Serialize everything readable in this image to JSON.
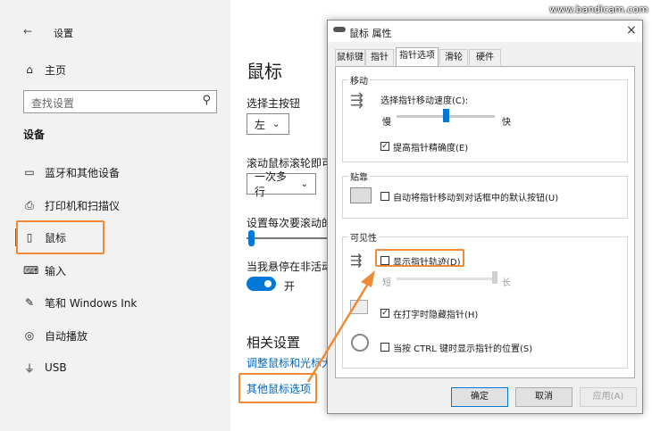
{
  "watermark": "www.bandicam.com",
  "settings": {
    "title": "设置",
    "home": "主页",
    "search_placeholder": "查找设置",
    "category": "设备",
    "nav": [
      "蓝牙和其他设备",
      "打印机和扫描仪",
      "鼠标",
      "输入",
      "笔和 Windows Ink",
      "自动播放",
      "USB"
    ],
    "page_title": "鼠标",
    "primary_button_label": "选择主按钮",
    "primary_button_value": "左",
    "scroll_label": "滚动鼠标滚轮即可",
    "scroll_value": "一次多行",
    "lines_label": "设置每次要滚动的",
    "inactive_scroll_label": "当我悬停在非活动",
    "toggle_state": "开",
    "related_title": "相关设置",
    "link_adjust": "调整鼠标和光标大",
    "link_other": "其他鼠标选项"
  },
  "dialog": {
    "title": "鼠标 属性",
    "close": "×",
    "tabs": [
      "鼠标键",
      "指针",
      "指针选项",
      "滑轮",
      "硬件"
    ],
    "active_tab": "指针选项",
    "motion": {
      "title": "移动",
      "speed_label": "选择指针移动速度(C):",
      "slow": "慢",
      "fast": "快",
      "speed_level": 0.5,
      "precision_label": "提高指针精确度(E)",
      "precision_checked": true
    },
    "snap": {
      "title": "贴靠",
      "label": "自动将指针移动到对话框中的默认按钮(U)",
      "checked": false
    },
    "visibility": {
      "title": "可见性",
      "trails_label": "显示指针轨迹(D)",
      "trails_checked": false,
      "short": "短",
      "long": "长",
      "trail_level": 1.0,
      "hide_label": "在打字时隐藏指针(H)",
      "hide_checked": true,
      "ctrl_label": "当按 CTRL 键时显示指针的位置(S)",
      "ctrl_checked": false
    },
    "buttons": {
      "ok": "确定",
      "cancel": "取消",
      "apply": "应用(A)"
    }
  },
  "colors": {
    "accent": "#0078d7",
    "highlight": "#f08a37",
    "link": "#0067c0"
  }
}
